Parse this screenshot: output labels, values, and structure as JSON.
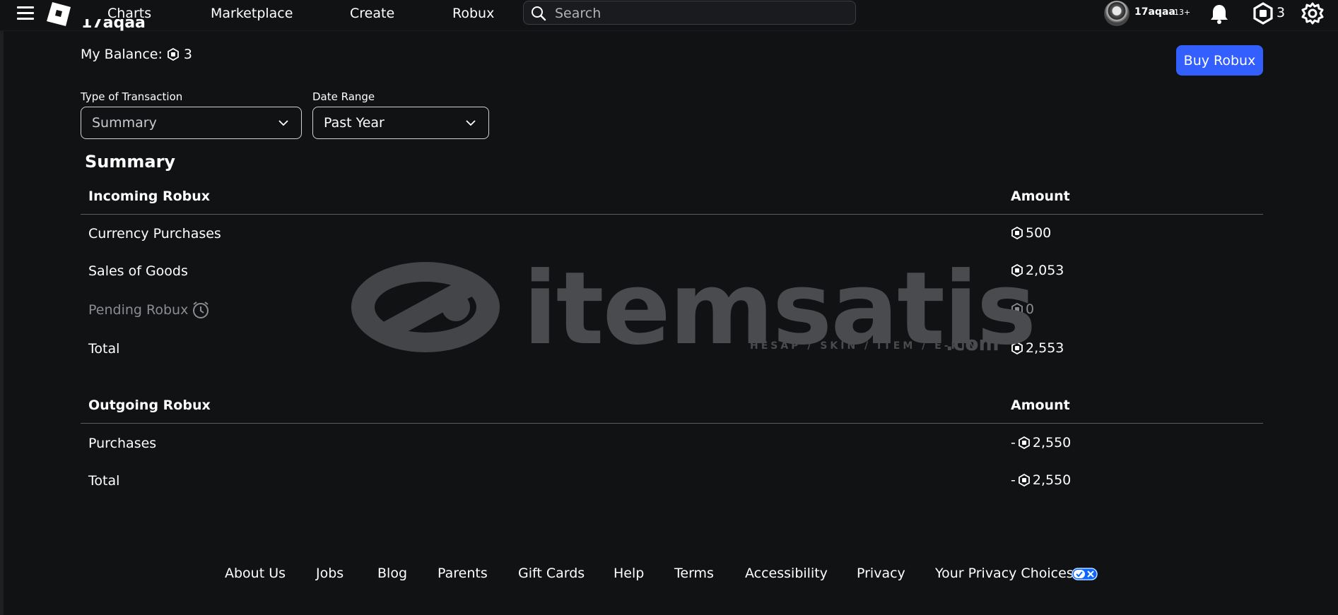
{
  "nav": {
    "links": [
      "Charts",
      "Marketplace",
      "Create",
      "Robux"
    ],
    "search_placeholder": "Search",
    "username": "17aqaa",
    "age_badge": "13+",
    "robux_count": "3"
  },
  "main": {
    "username_partial": "17aqaa",
    "balance_label": "My Balance:",
    "balance_value": "3",
    "buy_button": "Buy Robux",
    "filters": {
      "type_label": "Type of Transaction",
      "type_value": "Summary",
      "date_label": "Date Range",
      "date_value": "Past Year"
    },
    "section_title": "Summary",
    "incoming": {
      "header": "Incoming Robux",
      "amount_header": "Amount",
      "rows": [
        {
          "label": "Currency Purchases",
          "amount": "500"
        },
        {
          "label": "Sales of Goods",
          "amount": "2,053"
        },
        {
          "label": "Pending Robux",
          "amount": "0"
        },
        {
          "label": "Total",
          "amount": "2,553"
        }
      ]
    },
    "outgoing": {
      "header": "Outgoing Robux",
      "amount_header": "Amount",
      "rows": [
        {
          "label": "Purchases",
          "sign": "-",
          "amount": "2,550"
        },
        {
          "label": "Total",
          "sign": "-",
          "amount": "2,550"
        }
      ]
    }
  },
  "watermark": {
    "brand": "itemsatis",
    "tagline": "HESAP / SKIN / ITEM / E-PIN",
    "suffix": ".com"
  },
  "footer": {
    "links": [
      "About Us",
      "Jobs",
      "Blog",
      "Parents",
      "Gift Cards",
      "Help",
      "Terms",
      "Accessibility",
      "Privacy",
      "Your Privacy Choices"
    ]
  },
  "colors": {
    "background": "#111214",
    "accent_button": "#335fff",
    "muted_text": "#8a8c91"
  }
}
